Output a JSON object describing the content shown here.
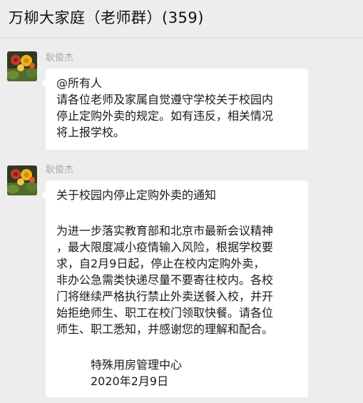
{
  "chat": {
    "title": "万柳大家庭（老师群）(359)"
  },
  "messages": [
    {
      "sender": "耿俊杰",
      "avatar_icon": "flower-photo-avatar",
      "lines": [
        "@所有人",
        "请各位老师及家属自觉遵守学校关于校园内",
        "停止定购外卖的规定。如有违反，相关情况",
        "将上报学校。"
      ]
    },
    {
      "sender": "耿俊杰",
      "avatar_icon": "flower-photo-avatar",
      "notice_title": "关于校园内停止定购外卖的通知",
      "body_lines": [
        "为进一步落实教育部和北京市最新会议精神",
        "，最大限度减小疫情输入风险，根据学校要",
        "求，自2月9日起，停止在校内定购外卖，",
        "非办公急需类快递尽量不要寄往校内。各校",
        "门将继续严格执行禁止外卖送餐入校，并开",
        "始拒绝师生、职工在校门领取快餐。请各位",
        "师生、职工悉知，并感谢您的理解和配合。"
      ],
      "signature": "特殊用房管理中心",
      "date": "2020年2月9日"
    }
  ]
}
